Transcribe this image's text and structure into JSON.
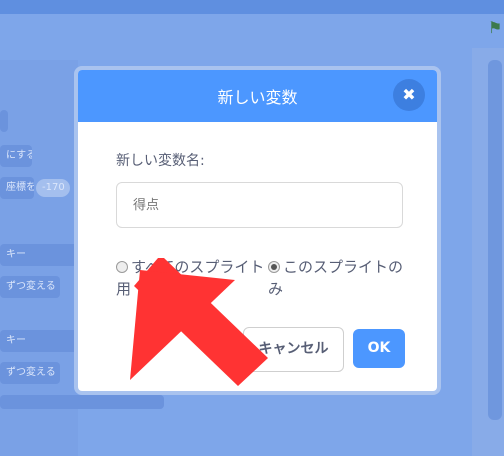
{
  "background": {
    "blocks": [
      "",
      "にする",
      "座標を",
      "-170",
      "ずつ変える",
      "ずつ変える",
      "キー",
      "キー"
    ]
  },
  "dialog": {
    "title": "新しい変数",
    "close_icon": "close-icon",
    "name_label": "新しい変数名:",
    "name_input": {
      "value": "",
      "placeholder": "得点"
    },
    "scope_options": [
      {
        "label": "すべてのスプライト用",
        "selected": false
      },
      {
        "label": "このスプライトのみ",
        "selected": true
      }
    ],
    "cancel_label": "キャンセル",
    "ok_label": "OK"
  },
  "overlay": {
    "pointer": "red-arrow-pointer",
    "color": "#ff3333"
  },
  "colors": {
    "accent": "#4c97ff",
    "text": "#575e75"
  }
}
